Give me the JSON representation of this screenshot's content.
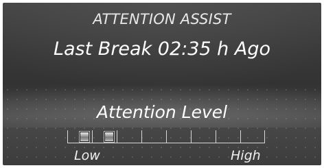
{
  "header": {
    "title": "ATTENTION ASSIST",
    "last_break": "Last Break 02:35 h Ago"
  },
  "level": {
    "title": "Attention Level",
    "low_label": "Low",
    "high_label": "High",
    "segments_total": 8,
    "segments_filled": 2,
    "fill_fraction": 0.25
  }
}
